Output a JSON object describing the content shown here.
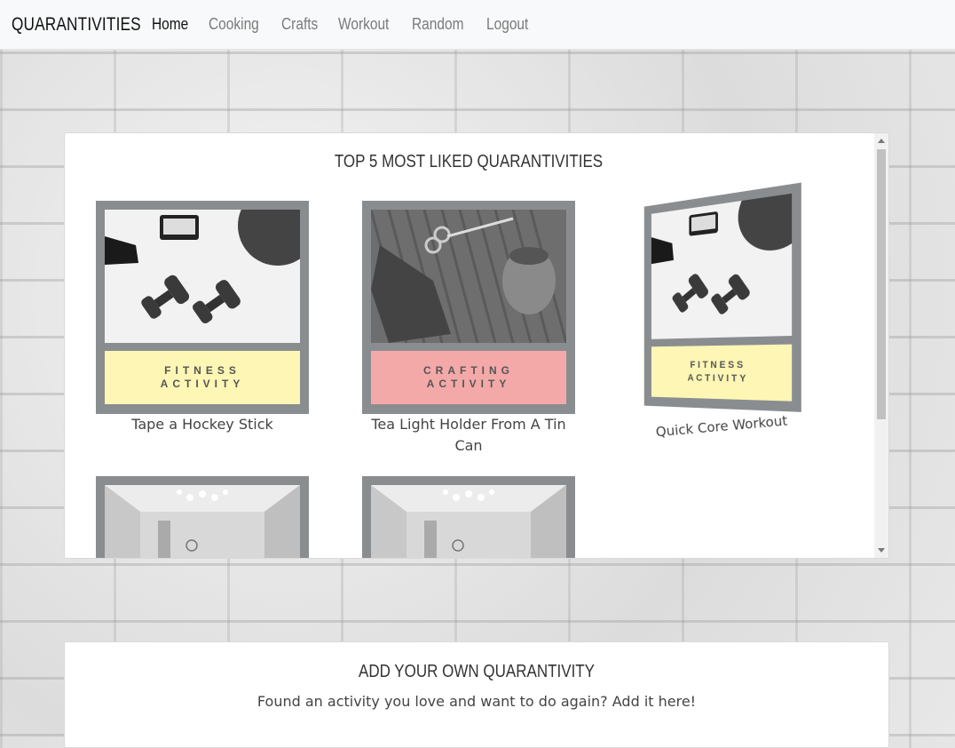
{
  "navbar": {
    "brand": "QUARANTIVITIES",
    "links": [
      "Home",
      "Cooking",
      "Crafts",
      "Workout",
      "Random",
      "Logout"
    ]
  },
  "top_section": {
    "title": "TOP 5 MOST LIKED QUARANTIVITIES",
    "items": [
      {
        "caption": "Tape a Hockey Stick",
        "label_line1": "FITNESS",
        "label_line2": "ACTIVITY",
        "label_color": "#fdf6b5",
        "image": "dumbbells-photo"
      },
      {
        "caption": "Tea Light Holder From A Tin Can",
        "label_line1": "CRAFTING",
        "label_line2": "ACTIVITY",
        "label_color": "#f4a9a9",
        "image": "twine-scissors-photo"
      },
      {
        "caption": "Quick Core Workout",
        "label_line1": "FITNESS",
        "label_line2": "ACTIVITY",
        "label_color": "#fdf6b5",
        "image": "dumbbells-photo"
      },
      {
        "caption": "",
        "image": "room-interior-photo"
      },
      {
        "caption": "",
        "image": "room-interior-photo"
      }
    ]
  },
  "add_section": {
    "title": "ADD YOUR OWN QUARANTIVITY",
    "subtitle": "Found an activity you love and want to do again? Add it here!"
  }
}
